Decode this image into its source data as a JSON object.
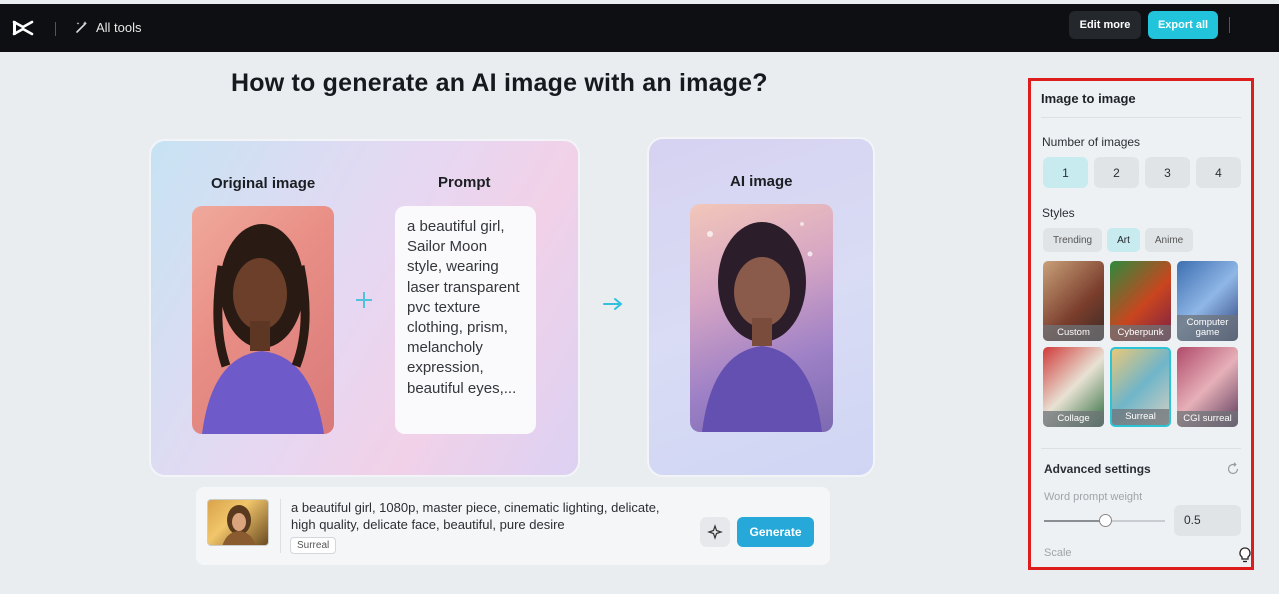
{
  "topbar": {
    "all_tools": "All tools",
    "edit_more": "Edit more",
    "export_all": "Export all"
  },
  "main": {
    "heading": "How to generate an AI image with an image?",
    "original_label": "Original image",
    "prompt_label": "Prompt",
    "ai_label": "AI image",
    "prompt_text": "a beautiful girl, Sailor Moon style, wearing laser transparent pvc texture clothing, prism, melancholy expression, beautiful eyes,...",
    "gen_bar": {
      "text": "a beautiful girl, 1080p, master piece, cinematic lighting, delicate, high quality, delicate face, beautiful, pure desire",
      "tag": "Surreal",
      "generate": "Generate"
    }
  },
  "panel": {
    "title": "Image to image",
    "number_label": "Number of images",
    "numbers": [
      "1",
      "2",
      "3",
      "4"
    ],
    "selected_number": "1",
    "styles_label": "Styles",
    "style_tabs": [
      "Trending",
      "Art",
      "Anime"
    ],
    "selected_tab": "Art",
    "styles": [
      "Custom",
      "Cyberpunk",
      "Computer game",
      "Collage",
      "Surreal",
      "CGI surreal"
    ],
    "selected_style": "Surreal",
    "advanced": "Advanced settings",
    "word_prompt_weight": "Word prompt weight",
    "weight_value": "0.5",
    "scale": "Scale"
  },
  "colors": {
    "accent": "#21c4da",
    "highlight_border": "#dd1c1c"
  }
}
